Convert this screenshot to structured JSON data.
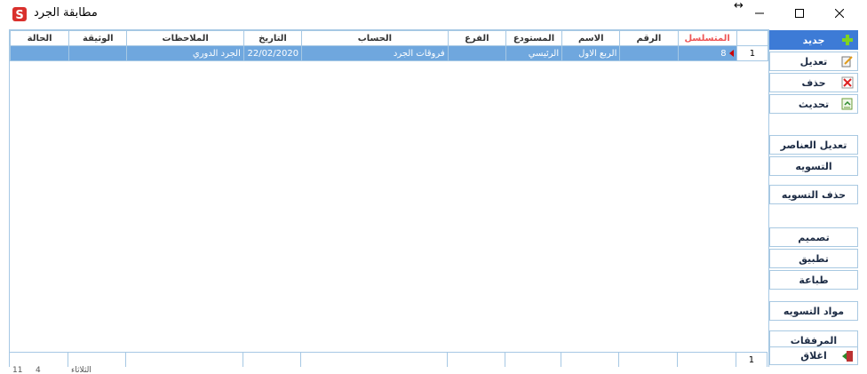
{
  "window": {
    "title": "مطابقة الجرد"
  },
  "table": {
    "headers": [
      "الحالة",
      "الوثيقة",
      "الملاحظات",
      "التاريخ",
      "الحساب",
      "الفرع",
      "المستودع",
      "الاسم",
      "الرقم",
      "المتسلسل",
      ""
    ],
    "rows": [
      {
        "status": "",
        "document": "",
        "notes": "الجرد الدوري",
        "date": "22/02/2020",
        "account": "فروقات الجرد",
        "branch": "",
        "warehouse": "الرئيسي",
        "name": "الربع الاول",
        "number": "",
        "serial": "8",
        "row": "1"
      }
    ],
    "footer_count": "1"
  },
  "buttons": {
    "new": "جديد",
    "edit": "تعديل",
    "delete": "حذف",
    "refresh": "تحديث",
    "edit_items": "تعديل العناصر",
    "settlement": "التسويه",
    "delete_settlement": "حذف التسويه",
    "design": "تصميم",
    "apply": "تطبيق",
    "print": "طباعة",
    "settlement_items": "مواد التسويه",
    "attachments": "المرفقات",
    "close": "اغلاق"
  },
  "taskbar": {
    "a": "11",
    "b": "4",
    "c": "الثلاثاء"
  },
  "colors": {
    "accent": "#3d7bd6",
    "selected_row": "#6fa7de",
    "grid_border": "#a6c8e4"
  }
}
